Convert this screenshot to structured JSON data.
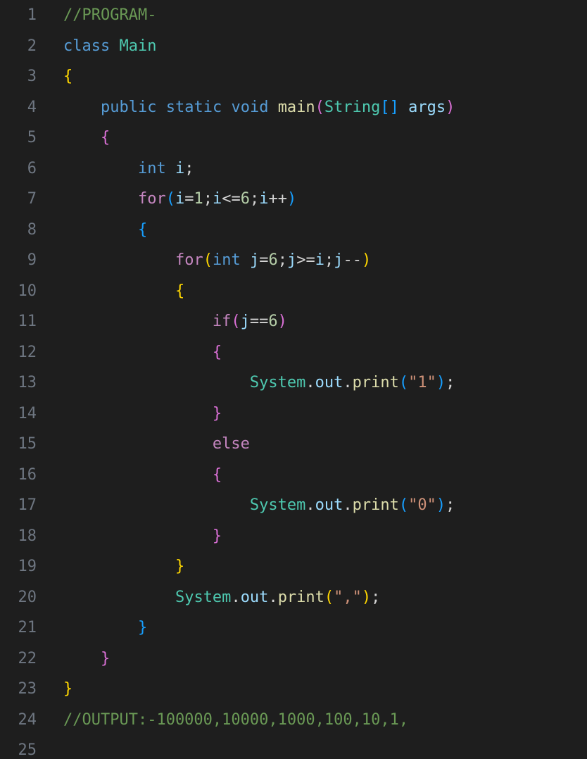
{
  "editor": {
    "lines": [
      {
        "number": "1",
        "indent": 0,
        "tokens": [
          {
            "t": "//PROGRAM-",
            "k": "comment"
          }
        ]
      },
      {
        "number": "2",
        "indent": 0,
        "tokens": [
          {
            "t": "class",
            "k": "keyword"
          },
          {
            "t": " ",
            "k": "plain"
          },
          {
            "t": "Main",
            "k": "type"
          }
        ]
      },
      {
        "number": "3",
        "indent": 0,
        "tokens": [
          {
            "t": "{",
            "k": "brace1"
          }
        ]
      },
      {
        "number": "4",
        "indent": 4,
        "tokens": [
          {
            "t": "public",
            "k": "keyword"
          },
          {
            "t": " ",
            "k": "plain"
          },
          {
            "t": "static",
            "k": "keyword"
          },
          {
            "t": " ",
            "k": "plain"
          },
          {
            "t": "void",
            "k": "keyword"
          },
          {
            "t": " ",
            "k": "plain"
          },
          {
            "t": "main",
            "k": "func"
          },
          {
            "t": "(",
            "k": "brace2"
          },
          {
            "t": "String",
            "k": "type"
          },
          {
            "t": "[]",
            "k": "brace3"
          },
          {
            "t": " ",
            "k": "plain"
          },
          {
            "t": "args",
            "k": "var"
          },
          {
            "t": ")",
            "k": "brace2"
          }
        ]
      },
      {
        "number": "5",
        "indent": 4,
        "tokens": [
          {
            "t": "{",
            "k": "brace2"
          }
        ]
      },
      {
        "number": "6",
        "indent": 8,
        "tokens": [
          {
            "t": "int",
            "k": "keyword"
          },
          {
            "t": " ",
            "k": "plain"
          },
          {
            "t": "i",
            "k": "var"
          },
          {
            "t": ";",
            "k": "punct"
          }
        ]
      },
      {
        "number": "7",
        "indent": 8,
        "tokens": [
          {
            "t": "for",
            "k": "control"
          },
          {
            "t": "(",
            "k": "brace3"
          },
          {
            "t": "i",
            "k": "var"
          },
          {
            "t": "=",
            "k": "punct"
          },
          {
            "t": "1",
            "k": "number"
          },
          {
            "t": ";",
            "k": "punct"
          },
          {
            "t": "i",
            "k": "var"
          },
          {
            "t": "<=",
            "k": "punct"
          },
          {
            "t": "6",
            "k": "number"
          },
          {
            "t": ";",
            "k": "punct"
          },
          {
            "t": "i",
            "k": "var"
          },
          {
            "t": "++",
            "k": "punct"
          },
          {
            "t": ")",
            "k": "brace3"
          }
        ]
      },
      {
        "number": "8",
        "indent": 8,
        "tokens": [
          {
            "t": "{",
            "k": "brace3"
          }
        ]
      },
      {
        "number": "9",
        "indent": 12,
        "tokens": [
          {
            "t": "for",
            "k": "control"
          },
          {
            "t": "(",
            "k": "brace1"
          },
          {
            "t": "int",
            "k": "keyword"
          },
          {
            "t": " ",
            "k": "plain"
          },
          {
            "t": "j",
            "k": "var"
          },
          {
            "t": "=",
            "k": "punct"
          },
          {
            "t": "6",
            "k": "number"
          },
          {
            "t": ";",
            "k": "punct"
          },
          {
            "t": "j",
            "k": "var"
          },
          {
            "t": ">=",
            "k": "punct"
          },
          {
            "t": "i",
            "k": "var"
          },
          {
            "t": ";",
            "k": "punct"
          },
          {
            "t": "j",
            "k": "var"
          },
          {
            "t": "--",
            "k": "punct"
          },
          {
            "t": ")",
            "k": "brace1"
          }
        ]
      },
      {
        "number": "10",
        "indent": 12,
        "tokens": [
          {
            "t": "{",
            "k": "brace1"
          }
        ]
      },
      {
        "number": "11",
        "indent": 16,
        "tokens": [
          {
            "t": "if",
            "k": "control"
          },
          {
            "t": "(",
            "k": "brace2"
          },
          {
            "t": "j",
            "k": "var"
          },
          {
            "t": "==",
            "k": "punct"
          },
          {
            "t": "6",
            "k": "number"
          },
          {
            "t": ")",
            "k": "brace2"
          }
        ]
      },
      {
        "number": "12",
        "indent": 16,
        "tokens": [
          {
            "t": "{",
            "k": "brace2"
          }
        ]
      },
      {
        "number": "13",
        "indent": 20,
        "tokens": [
          {
            "t": "System",
            "k": "type"
          },
          {
            "t": ".",
            "k": "punct"
          },
          {
            "t": "out",
            "k": "var"
          },
          {
            "t": ".",
            "k": "punct"
          },
          {
            "t": "print",
            "k": "func"
          },
          {
            "t": "(",
            "k": "brace3"
          },
          {
            "t": "\"1\"",
            "k": "string"
          },
          {
            "t": ")",
            "k": "brace3"
          },
          {
            "t": ";",
            "k": "punct"
          }
        ]
      },
      {
        "number": "14",
        "indent": 16,
        "tokens": [
          {
            "t": "}",
            "k": "brace2"
          }
        ]
      },
      {
        "number": "15",
        "indent": 16,
        "tokens": [
          {
            "t": "else",
            "k": "control"
          }
        ]
      },
      {
        "number": "16",
        "indent": 16,
        "tokens": [
          {
            "t": "{",
            "k": "brace2"
          }
        ]
      },
      {
        "number": "17",
        "indent": 20,
        "tokens": [
          {
            "t": "System",
            "k": "type"
          },
          {
            "t": ".",
            "k": "punct"
          },
          {
            "t": "out",
            "k": "var"
          },
          {
            "t": ".",
            "k": "punct"
          },
          {
            "t": "print",
            "k": "func"
          },
          {
            "t": "(",
            "k": "brace3"
          },
          {
            "t": "\"0\"",
            "k": "string"
          },
          {
            "t": ")",
            "k": "brace3"
          },
          {
            "t": ";",
            "k": "punct"
          }
        ]
      },
      {
        "number": "18",
        "indent": 16,
        "tokens": [
          {
            "t": "}",
            "k": "brace2"
          }
        ]
      },
      {
        "number": "19",
        "indent": 12,
        "tokens": [
          {
            "t": "}",
            "k": "brace1"
          }
        ]
      },
      {
        "number": "20",
        "indent": 12,
        "tokens": [
          {
            "t": "System",
            "k": "type"
          },
          {
            "t": ".",
            "k": "punct"
          },
          {
            "t": "out",
            "k": "var"
          },
          {
            "t": ".",
            "k": "punct"
          },
          {
            "t": "print",
            "k": "func"
          },
          {
            "t": "(",
            "k": "brace1"
          },
          {
            "t": "\",\"",
            "k": "string"
          },
          {
            "t": ")",
            "k": "brace1"
          },
          {
            "t": ";",
            "k": "punct"
          }
        ]
      },
      {
        "number": "21",
        "indent": 8,
        "tokens": [
          {
            "t": "}",
            "k": "brace3"
          }
        ]
      },
      {
        "number": "22",
        "indent": 4,
        "tokens": [
          {
            "t": "}",
            "k": "brace2"
          }
        ]
      },
      {
        "number": "23",
        "indent": 0,
        "tokens": [
          {
            "t": "}",
            "k": "brace1"
          }
        ]
      },
      {
        "number": "24",
        "indent": 0,
        "tokens": [
          {
            "t": "//OUTPUT:-100000,10000,1000,100,10,1,",
            "k": "comment"
          }
        ]
      },
      {
        "number": "25",
        "indent": 0,
        "tokens": []
      }
    ]
  },
  "colors": {
    "background": "#1e1e1e",
    "line_number": "#6e7681",
    "comment": "#6a9955",
    "keyword": "#569cd6",
    "control": "#c586c0",
    "type": "#4ec9b0",
    "function": "#dcdcaa",
    "variable": "#9cdcfe",
    "number": "#b5cea8",
    "string": "#ce9178"
  }
}
